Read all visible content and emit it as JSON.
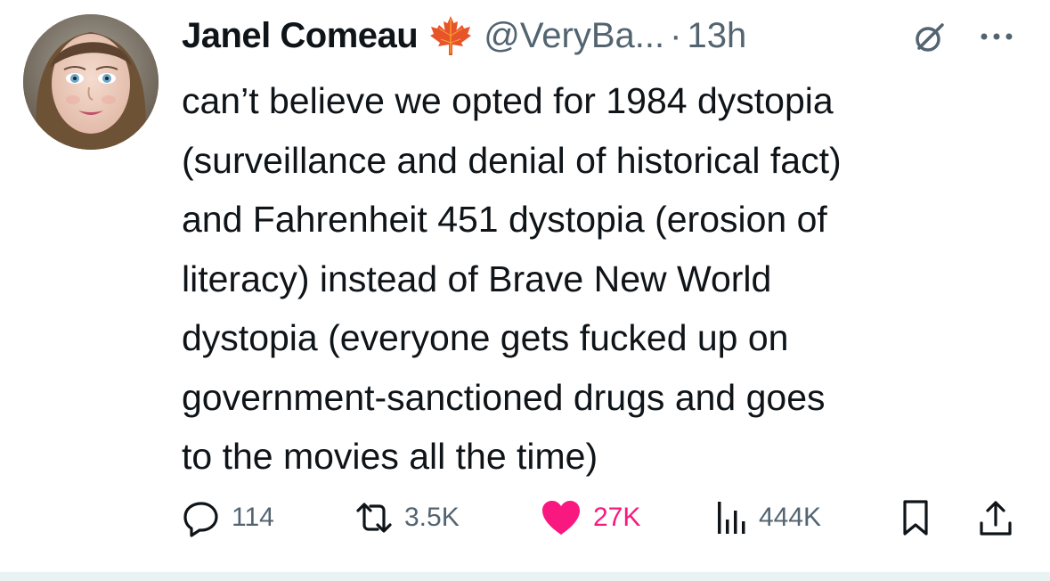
{
  "author": {
    "display_name": "Janel Comeau",
    "badge_icon": "maple-leaf-icon",
    "handle": "@VeryBa...",
    "separator": "·",
    "time": "13h"
  },
  "header_icons": {
    "grok": "grok-icon",
    "more": "more-icon"
  },
  "tweet": {
    "lines": [
      "can’t believe we opted for 1984 dystopia",
      "(surveillance and denial of historical fact)",
      "and Fahrenheit 451 dystopia (erosion of",
      "literacy) instead of Brave New World",
      "dystopia (everyone gets fucked up on",
      "government-sanctioned drugs and goes",
      "to the movies all the time)"
    ]
  },
  "actions": {
    "reply_count": "114",
    "retweet_count": "3.5K",
    "like_count": "27K",
    "views_count": "444K"
  },
  "colors": {
    "text": "#0f1419",
    "secondary": "#536471",
    "like": "#f91880",
    "maple": "#e8542a"
  }
}
